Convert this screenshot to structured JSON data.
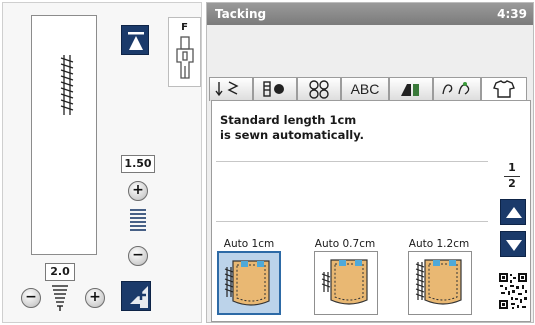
{
  "left": {
    "width_value": "1.50",
    "length_value": "2.0",
    "foot_letter": "F",
    "buttons": {
      "width_plus": "+",
      "width_minus": "−",
      "length_plus": "+",
      "length_minus": "−"
    }
  },
  "header": {
    "title": "Tacking",
    "time": "4:39"
  },
  "tabs": [
    {
      "label": "",
      "icon": "utility-stitch-icon"
    },
    {
      "label": "",
      "icon": "buttonhole-icon"
    },
    {
      "label": "",
      "icon": "decorative-stitch-icon"
    },
    {
      "label": "ABC",
      "icon": "alphabet"
    },
    {
      "label": "",
      "icon": "quilt-icon"
    },
    {
      "label": "",
      "icon": "applique-icon"
    },
    {
      "label": "",
      "icon": "garment-icon"
    }
  ],
  "message": {
    "line1": "Standard length 1cm",
    "line2": "is sewn automatically."
  },
  "page": {
    "current": "1",
    "total": "2"
  },
  "patterns": [
    {
      "label": "Auto 1cm",
      "selected": true
    },
    {
      "label": "Auto 0.7cm",
      "selected": false
    },
    {
      "label": "Auto 1.2cm",
      "selected": false
    }
  ],
  "colors": {
    "accent": "#1b3a6a",
    "selection": "#bcd3ea",
    "title_bar": "#8a8a8a"
  }
}
